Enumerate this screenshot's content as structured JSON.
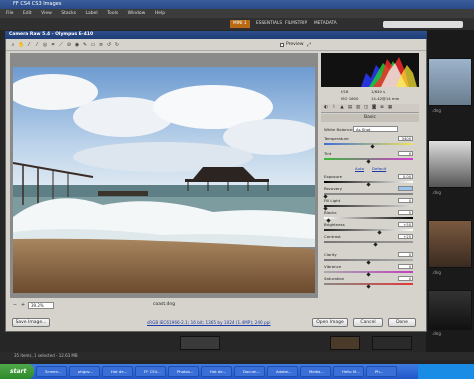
{
  "bridge": {
    "title": "FF CS4 CS3 Images",
    "menu": [
      "File",
      "Edit",
      "View",
      "Stacks",
      "Label",
      "Tools",
      "Window",
      "Help"
    ],
    "workspaces": [
      "MINI 1",
      "ESSENTIALS",
      "FILMSTRIP",
      "METADATA"
    ],
    "status": "35 items, 1 selected - 12.63 MB",
    "right_thumbs": [
      ".dng",
      ".dng",
      ".dng",
      ".dng"
    ]
  },
  "taskbar": {
    "start": "start",
    "tasks": [
      "Screen...",
      "phgov...",
      "Hot de...",
      "FF CS4...",
      "Photos...",
      "Hot de...",
      "Docum...",
      "Adobe...",
      "Media...",
      "Hello M...",
      "Ph..."
    ]
  },
  "camera_raw": {
    "title": "Camera Raw 5.4  -  Olympus E-410",
    "preview_label": "Preview",
    "zoom": "39.2%",
    "filename": "coast.dng",
    "workflow_link": "sRGB IEC61966-2.1; 16 bit; 1365 by 1024 (1.4MP); 240 ppi",
    "buttons": {
      "save": "Save Image...",
      "open": "Open Image",
      "cancel": "Cancel",
      "done": "Done"
    },
    "camera_info": {
      "aperture": "f/18",
      "shutter": "1/640 s",
      "iso": "ISO 1600",
      "focal": "14-42@14 mm"
    },
    "panel": {
      "header": "Basic",
      "white_balance_label": "White Balance:",
      "white_balance_value": "As Shot",
      "auto": "Auto",
      "default": "Default",
      "sliders": [
        {
          "label": "Temperature",
          "value": "5400",
          "pos": 0.55
        },
        {
          "label": "Tint",
          "value": "0",
          "pos": 0.5
        },
        {
          "label": "Exposure",
          "value": "0.00",
          "pos": 0.5
        },
        {
          "label": "Recovery",
          "value": "",
          "pos": 0.02
        },
        {
          "label": "Fill Light",
          "value": "0",
          "pos": 0.02
        },
        {
          "label": "Blacks",
          "value": "5",
          "pos": 0.05
        },
        {
          "label": "Brightness",
          "value": "+50",
          "pos": 0.62
        },
        {
          "label": "Contrast",
          "value": "+25",
          "pos": 0.58
        },
        {
          "label": "Clarity",
          "value": "0",
          "pos": 0.5
        },
        {
          "label": "Vibrance",
          "value": "0",
          "pos": 0.5
        },
        {
          "label": "Saturation",
          "value": "0",
          "pos": 0.5
        }
      ]
    }
  }
}
